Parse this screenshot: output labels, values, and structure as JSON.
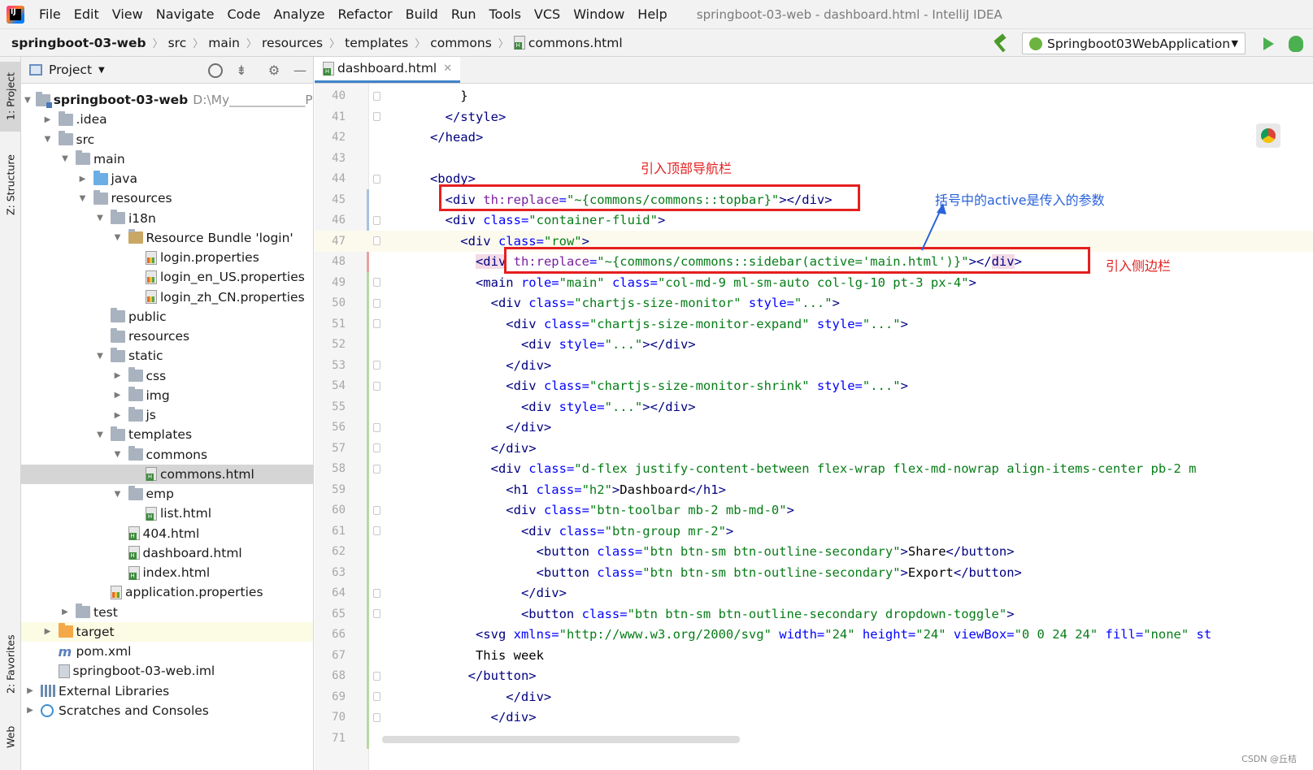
{
  "app": {
    "menu": [
      "File",
      "Edit",
      "View",
      "Navigate",
      "Code",
      "Analyze",
      "Refactor",
      "Build",
      "Run",
      "Tools",
      "VCS",
      "Window",
      "Help"
    ],
    "title": "springboot-03-web - dashboard.html - IntelliJ IDEA"
  },
  "breadcrumbs": [
    "springboot-03-web",
    "src",
    "main",
    "resources",
    "templates",
    "commons",
    "commons.html"
  ],
  "run_config": "Springboot03WebApplication",
  "tool_strip": {
    "project": "1: Project",
    "structure": "Z: Structure",
    "favorites": "2: Favorites",
    "web": "Web"
  },
  "project_panel": {
    "title": "Project",
    "tree": [
      {
        "label": "springboot-03-web",
        "extra": "D:\\My____________Pr",
        "icon": "folder-module",
        "depth": 0,
        "arrow": "down",
        "bold": true
      },
      {
        "label": ".idea",
        "icon": "folder",
        "depth": 1,
        "arrow": "right"
      },
      {
        "label": "src",
        "icon": "folder",
        "depth": 1,
        "arrow": "down"
      },
      {
        "label": "main",
        "icon": "folder",
        "depth": 2,
        "arrow": "down"
      },
      {
        "label": "java",
        "icon": "folder-blue",
        "depth": 3,
        "arrow": "right"
      },
      {
        "label": "resources",
        "icon": "folder",
        "depth": 3,
        "arrow": "down"
      },
      {
        "label": "i18n",
        "icon": "folder",
        "depth": 4,
        "arrow": "down"
      },
      {
        "label": "Resource Bundle 'login'",
        "icon": "bundle",
        "depth": 5,
        "arrow": "down"
      },
      {
        "label": "login.properties",
        "icon": "props",
        "depth": 6,
        "arrow": ""
      },
      {
        "label": "login_en_US.properties",
        "icon": "props",
        "depth": 6,
        "arrow": ""
      },
      {
        "label": "login_zh_CN.properties",
        "icon": "props",
        "depth": 6,
        "arrow": ""
      },
      {
        "label": "public",
        "icon": "folder",
        "depth": 4,
        "arrow": ""
      },
      {
        "label": "resources",
        "icon": "folder",
        "depth": 4,
        "arrow": ""
      },
      {
        "label": "static",
        "icon": "folder",
        "depth": 4,
        "arrow": "down"
      },
      {
        "label": "css",
        "icon": "folder",
        "depth": 5,
        "arrow": "right"
      },
      {
        "label": "img",
        "icon": "folder",
        "depth": 5,
        "arrow": "right"
      },
      {
        "label": "js",
        "icon": "folder",
        "depth": 5,
        "arrow": "right"
      },
      {
        "label": "templates",
        "icon": "folder",
        "depth": 4,
        "arrow": "down"
      },
      {
        "label": "commons",
        "icon": "folder",
        "depth": 5,
        "arrow": "down"
      },
      {
        "label": "commons.html",
        "icon": "html",
        "depth": 6,
        "arrow": "",
        "selected": true
      },
      {
        "label": "emp",
        "icon": "folder",
        "depth": 5,
        "arrow": "down"
      },
      {
        "label": "list.html",
        "icon": "html",
        "depth": 6,
        "arrow": ""
      },
      {
        "label": "404.html",
        "icon": "html",
        "depth": 5,
        "arrow": ""
      },
      {
        "label": "dashboard.html",
        "icon": "html",
        "depth": 5,
        "arrow": ""
      },
      {
        "label": "index.html",
        "icon": "html",
        "depth": 5,
        "arrow": ""
      },
      {
        "label": "application.properties",
        "icon": "spring",
        "depth": 4,
        "arrow": ""
      },
      {
        "label": "test",
        "icon": "folder",
        "depth": 2,
        "arrow": "right"
      },
      {
        "label": "target",
        "icon": "folder-orange",
        "depth": 1,
        "arrow": "right",
        "highlight": true
      },
      {
        "label": "pom.xml",
        "icon": "maven",
        "depth": 1,
        "arrow": ""
      },
      {
        "label": "springboot-03-web.iml",
        "icon": "iml",
        "depth": 1,
        "arrow": ""
      },
      {
        "label": "External Libraries",
        "icon": "libs",
        "depth": 0,
        "arrow": "right"
      },
      {
        "label": "Scratches and Consoles",
        "icon": "scratch",
        "depth": 0,
        "arrow": "right"
      }
    ]
  },
  "editor": {
    "tab": "dashboard.html",
    "current_line": 47,
    "lines": [
      {
        "n": 40,
        "indent": 20,
        "t": [
          [
            "pl",
            "}"
          ]
        ]
      },
      {
        "n": 41,
        "indent": 16,
        "t": [
          [
            "tg",
            "</"
          ],
          [
            "tg",
            "style"
          ],
          [
            "tg",
            ">"
          ]
        ]
      },
      {
        "n": 42,
        "indent": 12,
        "t": [
          [
            "tg",
            "</head>"
          ]
        ]
      },
      {
        "n": 43,
        "indent": 0,
        "t": []
      },
      {
        "n": 44,
        "indent": 12,
        "t": [
          [
            "tg",
            "<body>"
          ]
        ]
      },
      {
        "n": 45,
        "indent": 16,
        "t": [
          [
            "tg",
            "<div "
          ],
          [
            "th",
            "th:replace"
          ],
          [
            "an",
            "="
          ],
          [
            "sv",
            "\"~{commons/commons::topbar}\""
          ],
          [
            "tg",
            "></div>"
          ]
        ]
      },
      {
        "n": 46,
        "indent": 16,
        "t": [
          [
            "tg",
            "<div "
          ],
          [
            "an",
            "class="
          ],
          [
            "sv",
            "\"container-fluid\""
          ],
          [
            "tg",
            ">"
          ]
        ]
      },
      {
        "n": 47,
        "indent": 20,
        "t": [
          [
            "tg",
            "<div "
          ],
          [
            "an",
            "class="
          ],
          [
            "sv",
            "\"row\""
          ],
          [
            "tg",
            ">"
          ]
        ]
      },
      {
        "n": 48,
        "indent": 24,
        "t": [
          [
            "tg hl-tag",
            "<div"
          ],
          [
            "tg",
            " "
          ],
          [
            "th",
            "th:replace"
          ],
          [
            "an",
            "="
          ],
          [
            "sv",
            "\"~{commons/commons::sidebar(active='main.html')}\""
          ],
          [
            "tg",
            "></"
          ],
          [
            "tg hl-tag",
            "div"
          ],
          [
            "tg",
            ">"
          ]
        ]
      },
      {
        "n": 49,
        "indent": 24,
        "t": [
          [
            "tg",
            "<main "
          ],
          [
            "an",
            "role="
          ],
          [
            "sv",
            "\"main\""
          ],
          [
            "an",
            " class="
          ],
          [
            "sv",
            "\"col-md-9 ml-sm-auto col-lg-10 pt-3 px-4\""
          ],
          [
            "tg",
            ">"
          ]
        ]
      },
      {
        "n": 50,
        "indent": 28,
        "t": [
          [
            "tg",
            "<div "
          ],
          [
            "an",
            "class="
          ],
          [
            "sv",
            "\"chartjs-size-monitor\""
          ],
          [
            "an",
            " style="
          ],
          [
            "sv",
            "\"...\""
          ],
          [
            "tg",
            ">"
          ]
        ]
      },
      {
        "n": 51,
        "indent": 32,
        "t": [
          [
            "tg",
            "<div "
          ],
          [
            "an",
            "class="
          ],
          [
            "sv",
            "\"chartjs-size-monitor-expand\""
          ],
          [
            "an",
            " style="
          ],
          [
            "sv",
            "\"...\""
          ],
          [
            "tg",
            ">"
          ]
        ]
      },
      {
        "n": 52,
        "indent": 36,
        "t": [
          [
            "tg",
            "<div "
          ],
          [
            "an",
            "style="
          ],
          [
            "sv",
            "\"...\""
          ],
          [
            "tg",
            "></div>"
          ]
        ]
      },
      {
        "n": 53,
        "indent": 32,
        "t": [
          [
            "tg",
            "</div>"
          ]
        ]
      },
      {
        "n": 54,
        "indent": 32,
        "t": [
          [
            "tg",
            "<div "
          ],
          [
            "an",
            "class="
          ],
          [
            "sv",
            "\"chartjs-size-monitor-shrink\""
          ],
          [
            "an",
            " style="
          ],
          [
            "sv",
            "\"...\""
          ],
          [
            "tg",
            ">"
          ]
        ]
      },
      {
        "n": 55,
        "indent": 36,
        "t": [
          [
            "tg",
            "<div "
          ],
          [
            "an",
            "style="
          ],
          [
            "sv",
            "\"...\""
          ],
          [
            "tg",
            "></div>"
          ]
        ]
      },
      {
        "n": 56,
        "indent": 32,
        "t": [
          [
            "tg",
            "</div>"
          ]
        ]
      },
      {
        "n": 57,
        "indent": 28,
        "t": [
          [
            "tg",
            "</div>"
          ]
        ]
      },
      {
        "n": 58,
        "indent": 28,
        "t": [
          [
            "tg",
            "<div "
          ],
          [
            "an",
            "class="
          ],
          [
            "sv",
            "\"d-flex justify-content-between flex-wrap flex-md-nowrap align-items-center pb-2 m"
          ]
        ]
      },
      {
        "n": 59,
        "indent": 32,
        "t": [
          [
            "tg",
            "<h1 "
          ],
          [
            "an",
            "class="
          ],
          [
            "sv",
            "\"h2\""
          ],
          [
            "tg",
            ">"
          ],
          [
            "pl",
            "Dashboard"
          ],
          [
            "tg",
            "</h1>"
          ]
        ]
      },
      {
        "n": 60,
        "indent": 32,
        "t": [
          [
            "tg",
            "<div "
          ],
          [
            "an",
            "class="
          ],
          [
            "sv",
            "\"btn-toolbar mb-2 mb-md-0\""
          ],
          [
            "tg",
            ">"
          ]
        ]
      },
      {
        "n": 61,
        "indent": 36,
        "t": [
          [
            "tg",
            "<div "
          ],
          [
            "an",
            "class="
          ],
          [
            "sv",
            "\"btn-group mr-2\""
          ],
          [
            "tg",
            ">"
          ]
        ]
      },
      {
        "n": 62,
        "indent": 40,
        "t": [
          [
            "tg",
            "<button "
          ],
          [
            "an",
            "class="
          ],
          [
            "sv",
            "\"btn btn-sm btn-outline-secondary\""
          ],
          [
            "tg",
            ">"
          ],
          [
            "pl",
            "Share"
          ],
          [
            "tg",
            "</button>"
          ]
        ]
      },
      {
        "n": 63,
        "indent": 40,
        "t": [
          [
            "tg",
            "<button "
          ],
          [
            "an",
            "class="
          ],
          [
            "sv",
            "\"btn btn-sm btn-outline-secondary\""
          ],
          [
            "tg",
            ">"
          ],
          [
            "pl",
            "Export"
          ],
          [
            "tg",
            "</button>"
          ]
        ]
      },
      {
        "n": 64,
        "indent": 36,
        "t": [
          [
            "tg",
            "</div>"
          ]
        ]
      },
      {
        "n": 65,
        "indent": 36,
        "t": [
          [
            "tg",
            "<button "
          ],
          [
            "an",
            "class="
          ],
          [
            "sv",
            "\"btn btn-sm btn-outline-secondary dropdown-toggle\""
          ],
          [
            "tg",
            ">"
          ]
        ]
      },
      {
        "n": 66,
        "indent": 24,
        "t": [
          [
            "tg",
            "<svg "
          ],
          [
            "an",
            "xmlns="
          ],
          [
            "sv",
            "\"http://www.w3.org/2000/svg\""
          ],
          [
            "an",
            " width="
          ],
          [
            "sv",
            "\"24\""
          ],
          [
            "an",
            " height="
          ],
          [
            "sv",
            "\"24\""
          ],
          [
            "an",
            " viewBox="
          ],
          [
            "sv",
            "\"0 0 24 24\""
          ],
          [
            "an",
            " fill="
          ],
          [
            "sv",
            "\"none\""
          ],
          [
            "an",
            " st"
          ]
        ]
      },
      {
        "n": 67,
        "indent": 24,
        "t": [
          [
            "pl",
            "This week"
          ]
        ]
      },
      {
        "n": 68,
        "indent": 22,
        "t": [
          [
            "tg",
            "</button>"
          ]
        ]
      },
      {
        "n": 69,
        "indent": 32,
        "t": [
          [
            "tg",
            "</div>"
          ]
        ]
      },
      {
        "n": 70,
        "indent": 28,
        "t": [
          [
            "tg",
            "</div>"
          ]
        ]
      },
      {
        "n": 71,
        "indent": 0,
        "t": []
      }
    ]
  },
  "annotations": {
    "topbar_note": "引入顶部导航栏",
    "param_note": "括号中的active是传入的参数",
    "sidebar_note": "引入侧边栏"
  },
  "watermark": "CSDN @丘桔"
}
